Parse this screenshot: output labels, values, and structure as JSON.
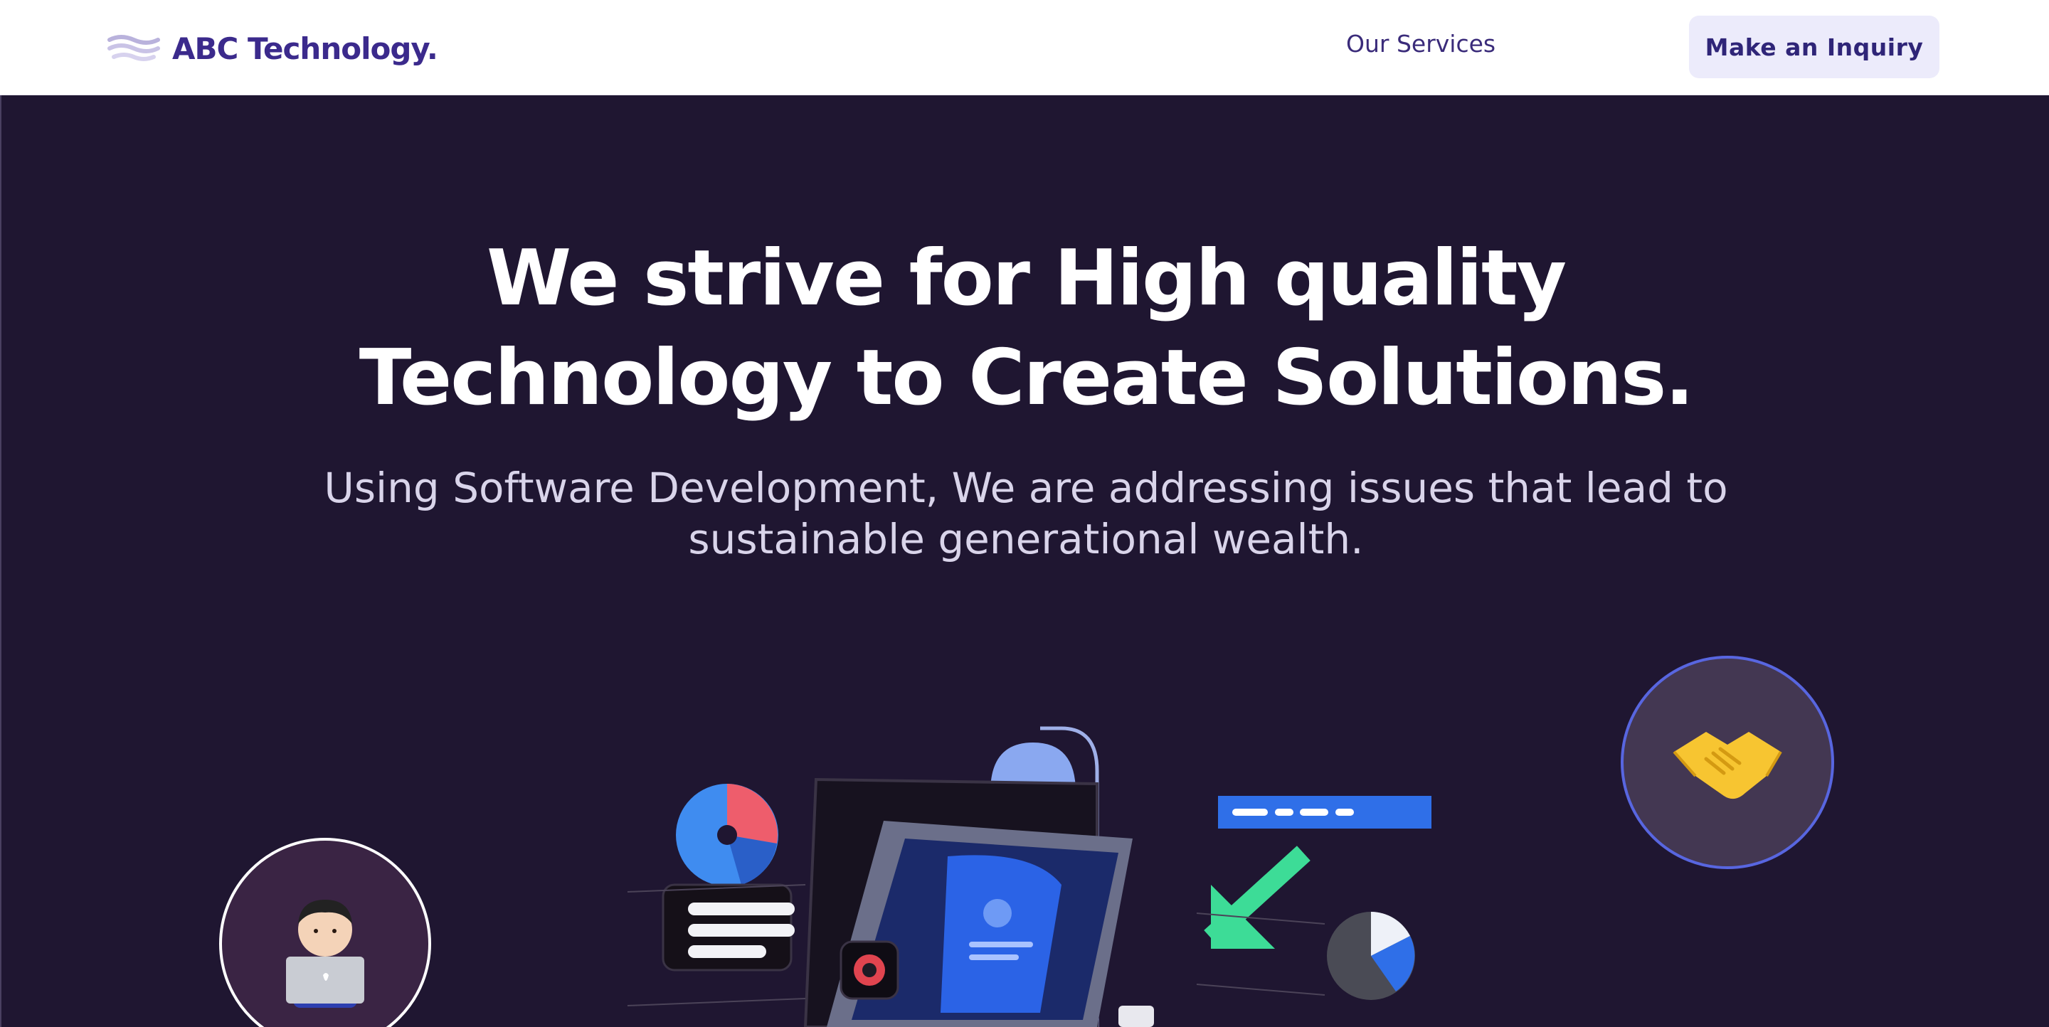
{
  "nav": {
    "brand": "ABC Technology.",
    "links": [
      "Our Services"
    ],
    "cta_label": "Make an Inquiry"
  },
  "hero": {
    "headline_line1": "We strive for High quality",
    "headline_line2": "Technology to Create Solutions.",
    "subtitle_line1": "Using Software Development, We are addressing issues that lead to",
    "subtitle_line2": "sustainable generational wealth."
  },
  "icons": {
    "logo": "waves-logo-icon",
    "left_avatar": "person-with-laptop-icon",
    "right_avatar": "handshake-icon",
    "illustration": "workspace-illustration"
  },
  "colors": {
    "brand": "#3b2a8c",
    "hero_bg": "#1f1631",
    "cta_bg": "#ecebfb",
    "accent_blue": "#2f6fe8",
    "accent_green": "#3ddc97"
  }
}
